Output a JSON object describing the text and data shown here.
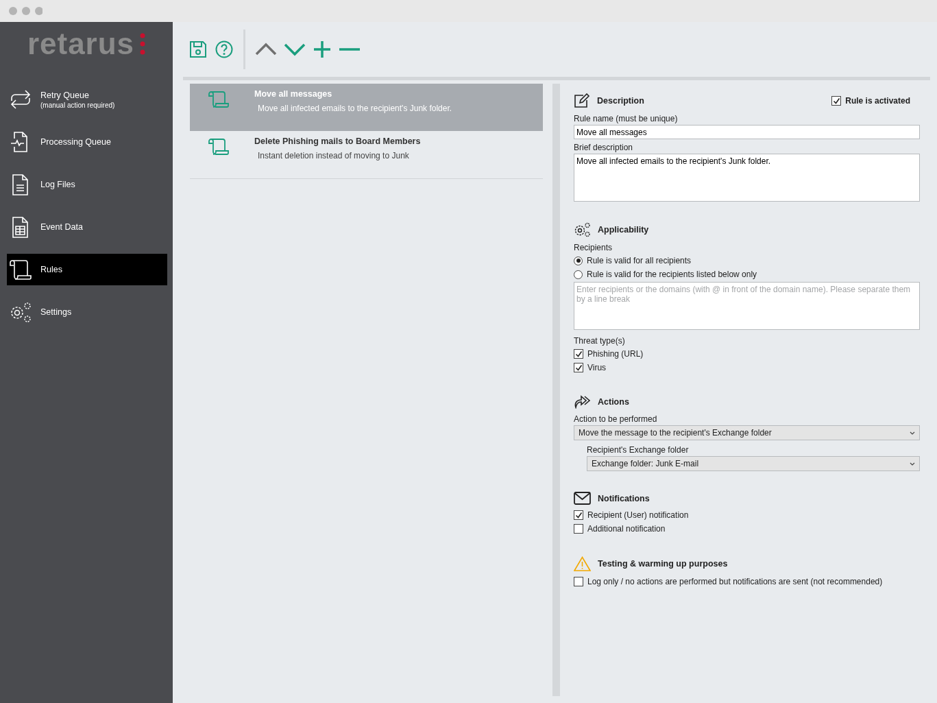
{
  "logo": {
    "text": "retarus"
  },
  "sidebar": {
    "items": [
      {
        "kind": "retry",
        "label": "Retry Queue",
        "sublabel": "(manual action required)",
        "selected": false
      },
      {
        "kind": "processing",
        "label": "Processing Queue",
        "selected": false
      },
      {
        "kind": "log",
        "label": "Log Files",
        "selected": false
      },
      {
        "kind": "event",
        "label": "Event Data",
        "selected": false
      },
      {
        "kind": "rules",
        "label": "Rules",
        "selected": true
      },
      {
        "kind": "settings",
        "label": "Settings",
        "selected": false
      }
    ]
  },
  "toolbar": {
    "buttons": [
      {
        "kind": "save",
        "disabled": false
      },
      {
        "kind": "help",
        "disabled": false
      },
      {
        "kind": "up",
        "disabled": true
      },
      {
        "kind": "down",
        "disabled": false
      },
      {
        "kind": "add",
        "disabled": false
      },
      {
        "kind": "remove",
        "disabled": false
      }
    ]
  },
  "rules": [
    {
      "name": "Move all messages",
      "description": "Move all infected emails to the recipient's Junk folder.",
      "selected": true
    },
    {
      "name": "Delete Phishing mails to Board Members",
      "description": "Instant deletion instead of moving to Junk",
      "selected": false
    }
  ],
  "details": {
    "description": {
      "title": "Description",
      "activated": {
        "label": "Rule is activated",
        "checked": true
      },
      "name_label": "Rule name (must be unique)",
      "name_value": "Move all messages",
      "brief_label": "Brief description",
      "brief_value": "Move all infected emails to the recipient's Junk folder."
    },
    "applicability": {
      "title": "Applicability",
      "recipients_label": "Recipients",
      "recipient_options": [
        {
          "label": "Rule is valid for all recipients",
          "selected": true
        },
        {
          "label": "Rule is valid for the recipients listed below only",
          "selected": false
        }
      ],
      "recipients_placeholder": "Enter recipients or the domains (with @ in front of the domain name). Please separate them by a line break",
      "threat_label": "Threat type(s)",
      "threats": [
        {
          "label": "Phishing (URL)",
          "checked": true
        },
        {
          "label": "Virus",
          "checked": true
        }
      ]
    },
    "actions": {
      "title": "Actions",
      "action_label": "Action to be performed",
      "action_value": "Move the message to the recipient's Exchange folder",
      "folder_label": "Recipient's Exchange folder",
      "folder_value": "Exchange folder: Junk E-mail"
    },
    "notifications": {
      "title": "Notifications",
      "options": [
        {
          "label": "Recipient (User) notification",
          "checked": true
        },
        {
          "label": "Additional notification",
          "checked": false
        }
      ]
    },
    "testing": {
      "title": "Testing & warming up purposes",
      "options": [
        {
          "label": "Log only / no actions are performed but notifications are sent (not recommended)",
          "checked": false
        }
      ]
    }
  }
}
